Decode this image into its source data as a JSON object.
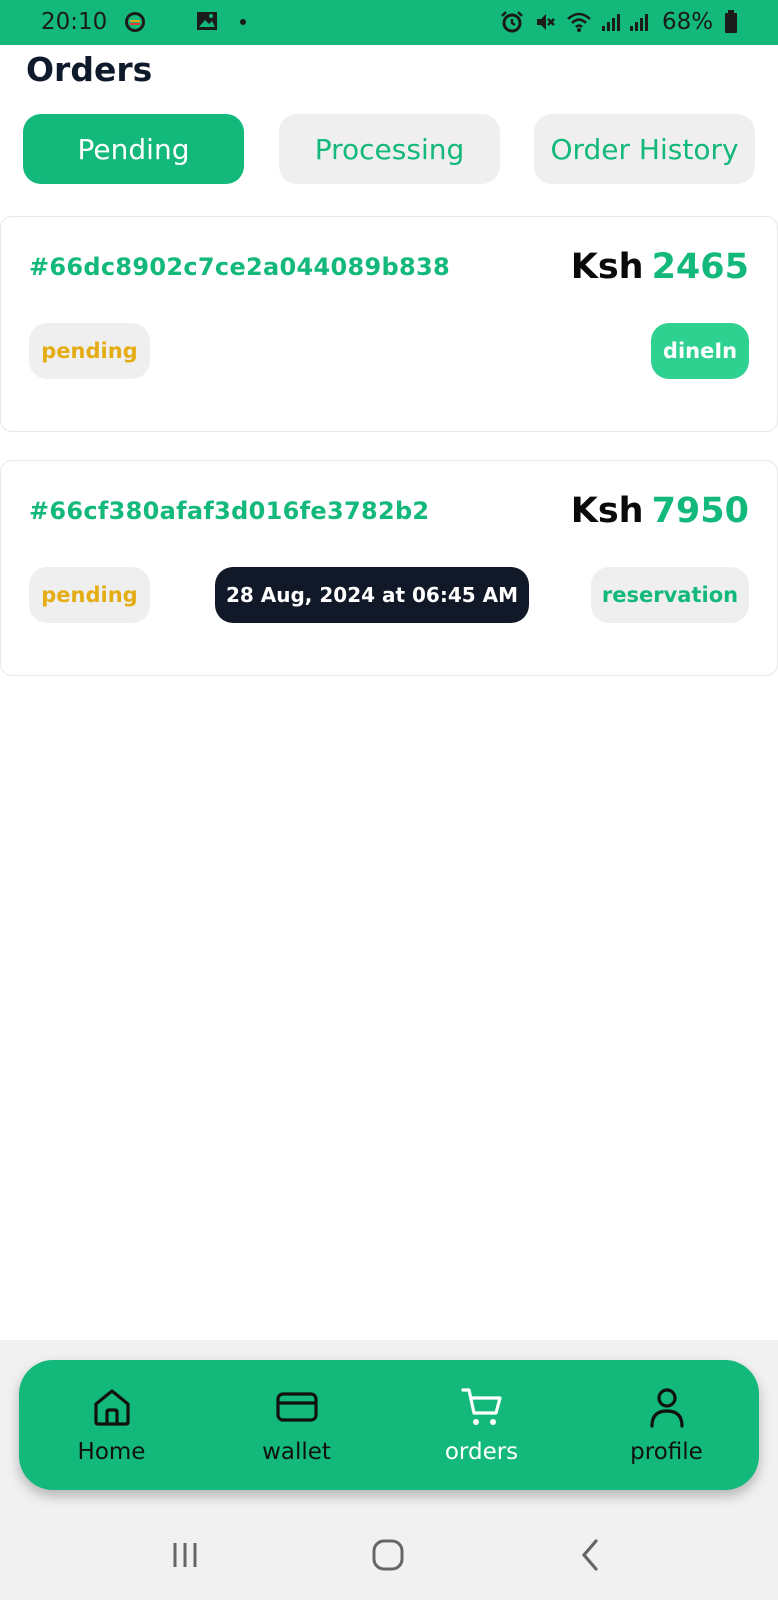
{
  "status_bar": {
    "time": "20:10",
    "battery": "68%",
    "icons": [
      "notification-icon",
      "gallery-icon",
      "alarm-icon",
      "mute-icon",
      "wifi-icon",
      "signal-icon",
      "battery-icon"
    ]
  },
  "header": {
    "title": "Orders"
  },
  "tabs": [
    {
      "label": "Pending",
      "active": true
    },
    {
      "label": "Processing",
      "active": false
    },
    {
      "label": "Order History",
      "active": false
    }
  ],
  "orders": [
    {
      "id": "#66dc8902c7ce2a044089b838",
      "currency": "Ksh",
      "amount": "2465",
      "status": "pending",
      "type": "dineIn"
    },
    {
      "id": "#66cf380afaf3d016fe3782b2",
      "currency": "Ksh",
      "amount": "7950",
      "status": "pending",
      "date": "28 Aug, 2024  at 06:45 AM",
      "type": "reservation"
    }
  ],
  "bottom_nav": [
    {
      "label": "Home",
      "icon": "home-icon",
      "active": false
    },
    {
      "label": "wallet",
      "icon": "wallet-icon",
      "active": false
    },
    {
      "label": "orders",
      "icon": "cart-icon",
      "active": true
    },
    {
      "label": "profile",
      "icon": "user-icon",
      "active": false
    }
  ],
  "colors": {
    "accent": "#13b87b",
    "pending": "#e5ad14",
    "dark": "#111827"
  }
}
